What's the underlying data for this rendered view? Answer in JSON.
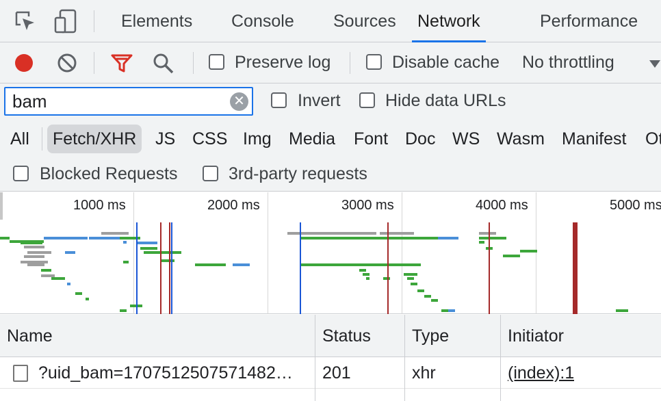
{
  "tabs": [
    {
      "label": "Elements"
    },
    {
      "label": "Console"
    },
    {
      "label": "Sources"
    },
    {
      "label": "Network",
      "active": true
    },
    {
      "label": "Performance"
    }
  ],
  "toolbar": {
    "preserve_log": "Preserve log",
    "disable_cache": "Disable cache",
    "throttling": "No throttling"
  },
  "filter": {
    "value": "bam",
    "invert": "Invert",
    "hide_data_urls": "Hide data URLs"
  },
  "types": [
    "All",
    "Fetch/XHR",
    "JS",
    "CSS",
    "Img",
    "Media",
    "Font",
    "Doc",
    "WS",
    "Wasm",
    "Manifest",
    "Ot"
  ],
  "selected_type": "Fetch/XHR",
  "blocked": {
    "blocked_requests": "Blocked Requests",
    "third_party": "3rd-party requests"
  },
  "overview": {
    "ticks": [
      "1000 ms",
      "2000 ms",
      "3000 ms",
      "4000 ms",
      "5000 ms"
    ]
  },
  "table": {
    "headers": {
      "name": "Name",
      "status": "Status",
      "type": "Type",
      "initiator": "Initiator"
    },
    "rows": [
      {
        "name": "?uid_bam=1707512507571482…",
        "status": "201",
        "type": "xhr",
        "initiator": "(index):1"
      }
    ]
  },
  "colors": {
    "record": "#d93025",
    "accent": "#1a73e8",
    "filter_icon": "#d93025",
    "bar_green": "#3da63b",
    "bar_blue": "#4a8fd8",
    "bar_gray": "#9e9e9e",
    "marker_red": "#a52a2a",
    "marker_blue": "#1a56d6"
  },
  "icons": [
    "inspect-icon",
    "device-icon",
    "record-icon",
    "clear-icon",
    "filter-icon",
    "search-icon",
    "dropdown-icon",
    "clear-input-icon",
    "checkbox-icon"
  ]
}
